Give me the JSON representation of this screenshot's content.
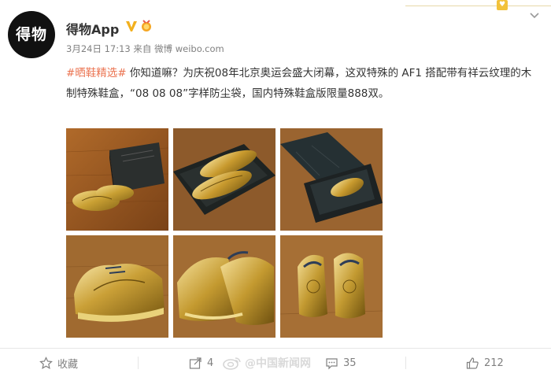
{
  "account": {
    "name": "得物App",
    "avatar_text": "得物",
    "verified_icon": "verified-v-icon",
    "medal_icon": "medal-icon"
  },
  "post": {
    "date": "3月24日 17:13",
    "source_prefix": "来自",
    "source": "微博 weibo.com",
    "hashtag": "#晒鞋精选#",
    "body": " 你知道嘛？为庆祝08年北京奥运会盛大闭幕，这双特殊的 AF1 搭配带有祥云纹理的木制特殊鞋盒，“08 08 08”字样防尘袋，国内特殊鞋盒版限量888双。"
  },
  "gallery": {
    "images": [
      {
        "icon": "shoe-box-photo-icon"
      },
      {
        "icon": "shoes-in-box-photo-icon"
      },
      {
        "icon": "open-box-photo-icon"
      },
      {
        "icon": "shoe-side-photo-icon"
      },
      {
        "icon": "shoe-heel-photo-icon"
      },
      {
        "icon": "shoe-back-photo-icon"
      }
    ]
  },
  "actions": {
    "favorite_label": "收藏",
    "forward_count": "4",
    "comment_count": "35",
    "like_count": "212"
  },
  "watermark": {
    "text": "@中国新闻网"
  },
  "colors": {
    "link_orange": "#eb7350",
    "meta_gray": "#808080",
    "text": "#333333",
    "verified_yellow": "#f2b01e",
    "gold": "#c9a033"
  }
}
